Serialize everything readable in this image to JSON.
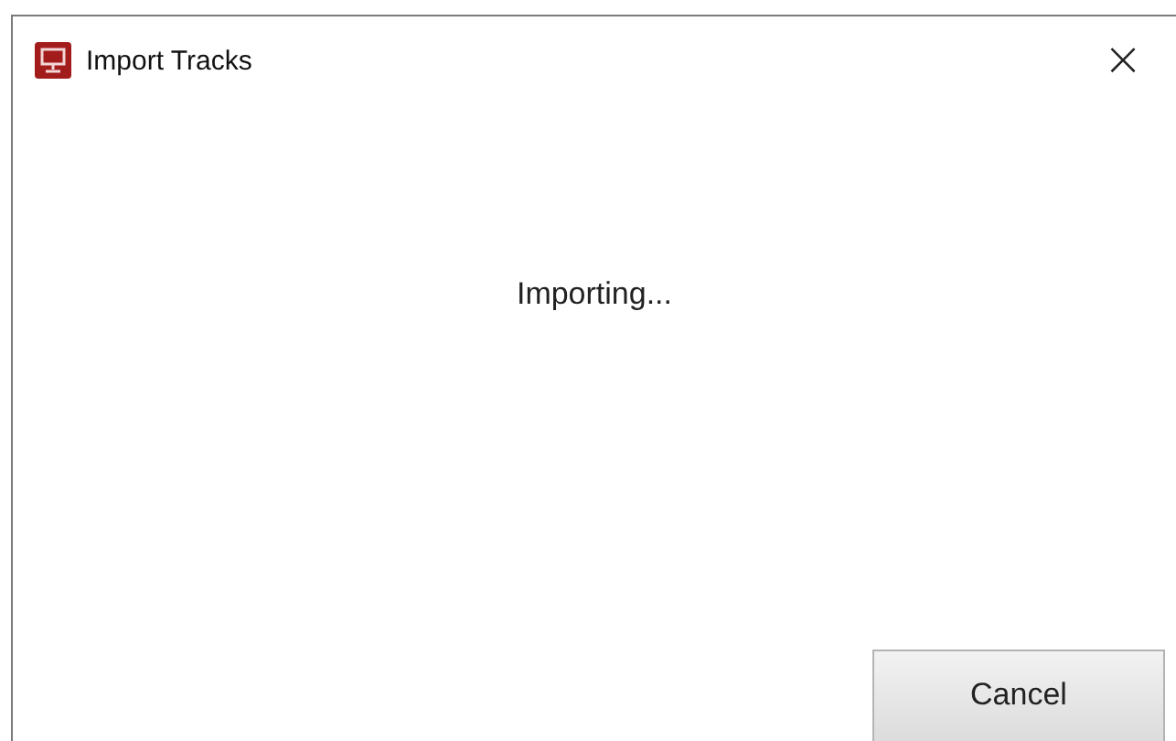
{
  "window": {
    "title": "Import Tracks",
    "close": "×"
  },
  "status": "Importing...",
  "buttons": [
    "Cancel"
  ]
}
